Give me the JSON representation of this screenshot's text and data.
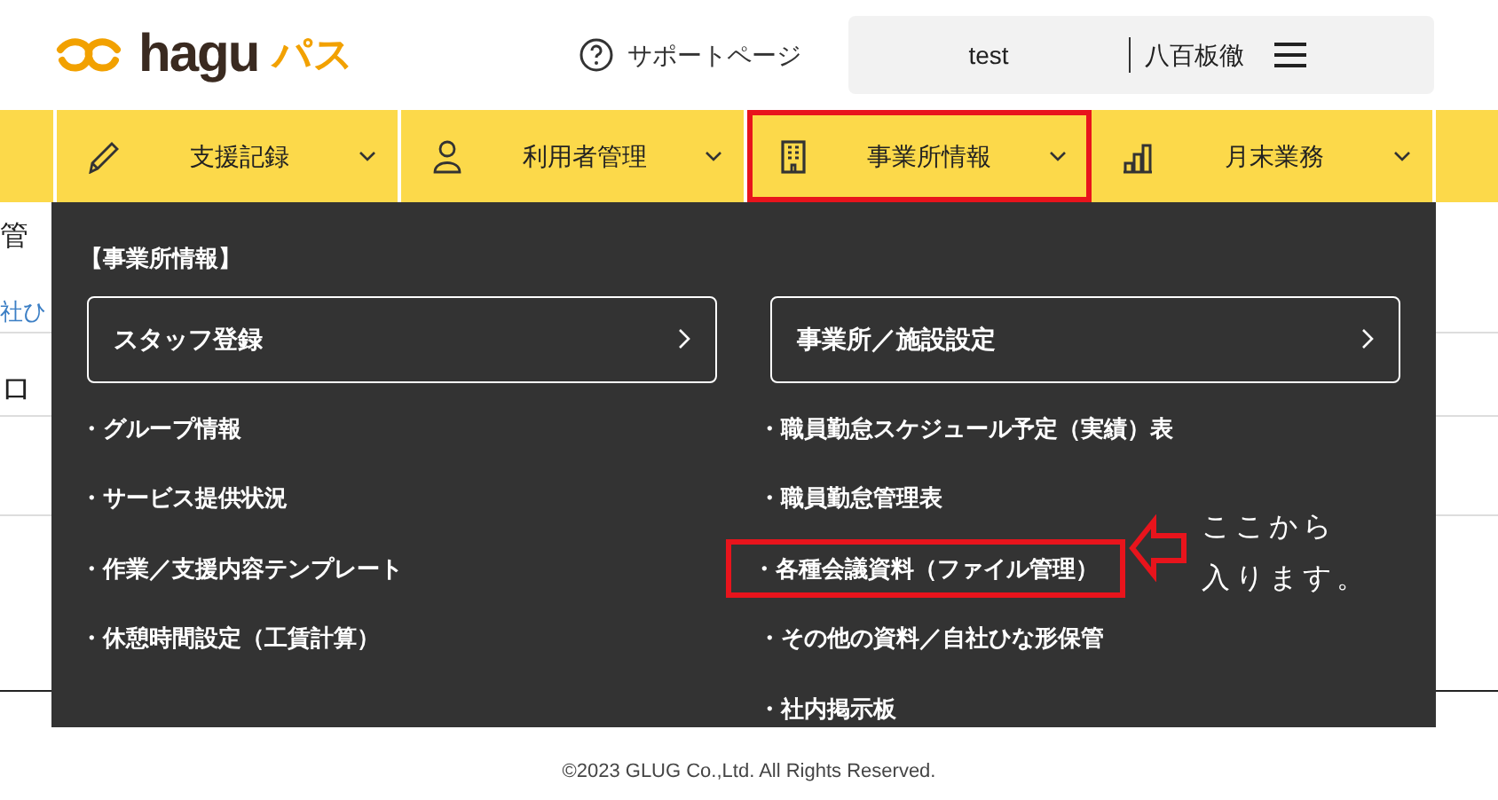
{
  "header": {
    "logo_text": "hagu",
    "logo_suffix": "パス",
    "support_link": "サポートページ",
    "user_box": {
      "facility": "test",
      "user": "八百板徹"
    }
  },
  "nav": [
    {
      "label": "支援記録",
      "highlighted": false
    },
    {
      "label": "利用者管理",
      "highlighted": false
    },
    {
      "label": "事業所情報",
      "highlighted": true
    },
    {
      "label": "月末業務",
      "highlighted": false
    }
  ],
  "background_page": {
    "title_fragment": "管",
    "link_fragment": "社ひ",
    "heading_fragment": "ロ"
  },
  "dropdown": {
    "title": "【事業所情報】",
    "buttons": [
      "スタッフ登録",
      "事業所／施設設定"
    ],
    "columns": [
      [
        {
          "label": "・グループ情報",
          "highlighted": false
        },
        {
          "label": "・サービス提供状況",
          "highlighted": false
        },
        {
          "label": "・作業／支援内容テンプレート",
          "highlighted": false
        },
        {
          "label": "・休憩時間設定（工賃計算）",
          "highlighted": false
        }
      ],
      [
        {
          "label": "・職員勤怠スケジュール予定（実績）表",
          "highlighted": false
        },
        {
          "label": "・職員勤怠管理表",
          "highlighted": false
        },
        {
          "label": "・各種会議資料（ファイル管理）",
          "highlighted": true
        },
        {
          "label": "・その他の資料／自社ひな形保管",
          "highlighted": false
        },
        {
          "label": "・社内掲示板",
          "highlighted": false
        }
      ]
    ]
  },
  "callout": {
    "lines": [
      "ここから",
      "入ります。"
    ]
  },
  "footer": "©2023 GLUG Co.,Ltd. All Rights Reserved."
}
